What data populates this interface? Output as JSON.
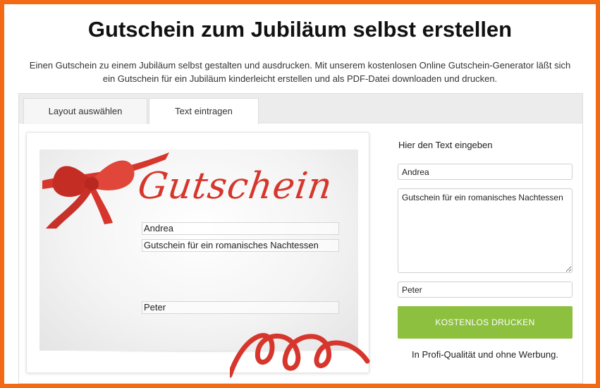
{
  "page": {
    "title": "Gutschein zum Jubiläum selbst erstellen",
    "intro": "Einen Gutschein zu einem Jubiläum selbst gestalten und ausdrucken. Mit unserem kostenlosen Online Gutschein-Generator läßt sich ein Gutschein für ein Jubiläum kinderleicht erstellen und als PDF-Datei downloaden und drucken."
  },
  "tabs": [
    {
      "label": "Layout auswählen"
    },
    {
      "label": "Text eintragen"
    }
  ],
  "voucher": {
    "heading": "Gutschein",
    "name": "Andrea",
    "text": "Gutschein für ein romanisches Nachtessen",
    "from": "Peter",
    "ribbon_color": "#d6362c"
  },
  "form": {
    "label": "Hier den Text eingeben",
    "name_value": "Andrea",
    "text_value": "Gutschein für ein romanisches Nachtessen",
    "from_value": "Peter",
    "print_button": "KOSTENLOS DRUCKEN",
    "note": "In Profi-Qualität und ohne Werbung."
  },
  "colors": {
    "frame": "#f26a14",
    "button": "#8cc03e",
    "accent": "#d6362c"
  }
}
